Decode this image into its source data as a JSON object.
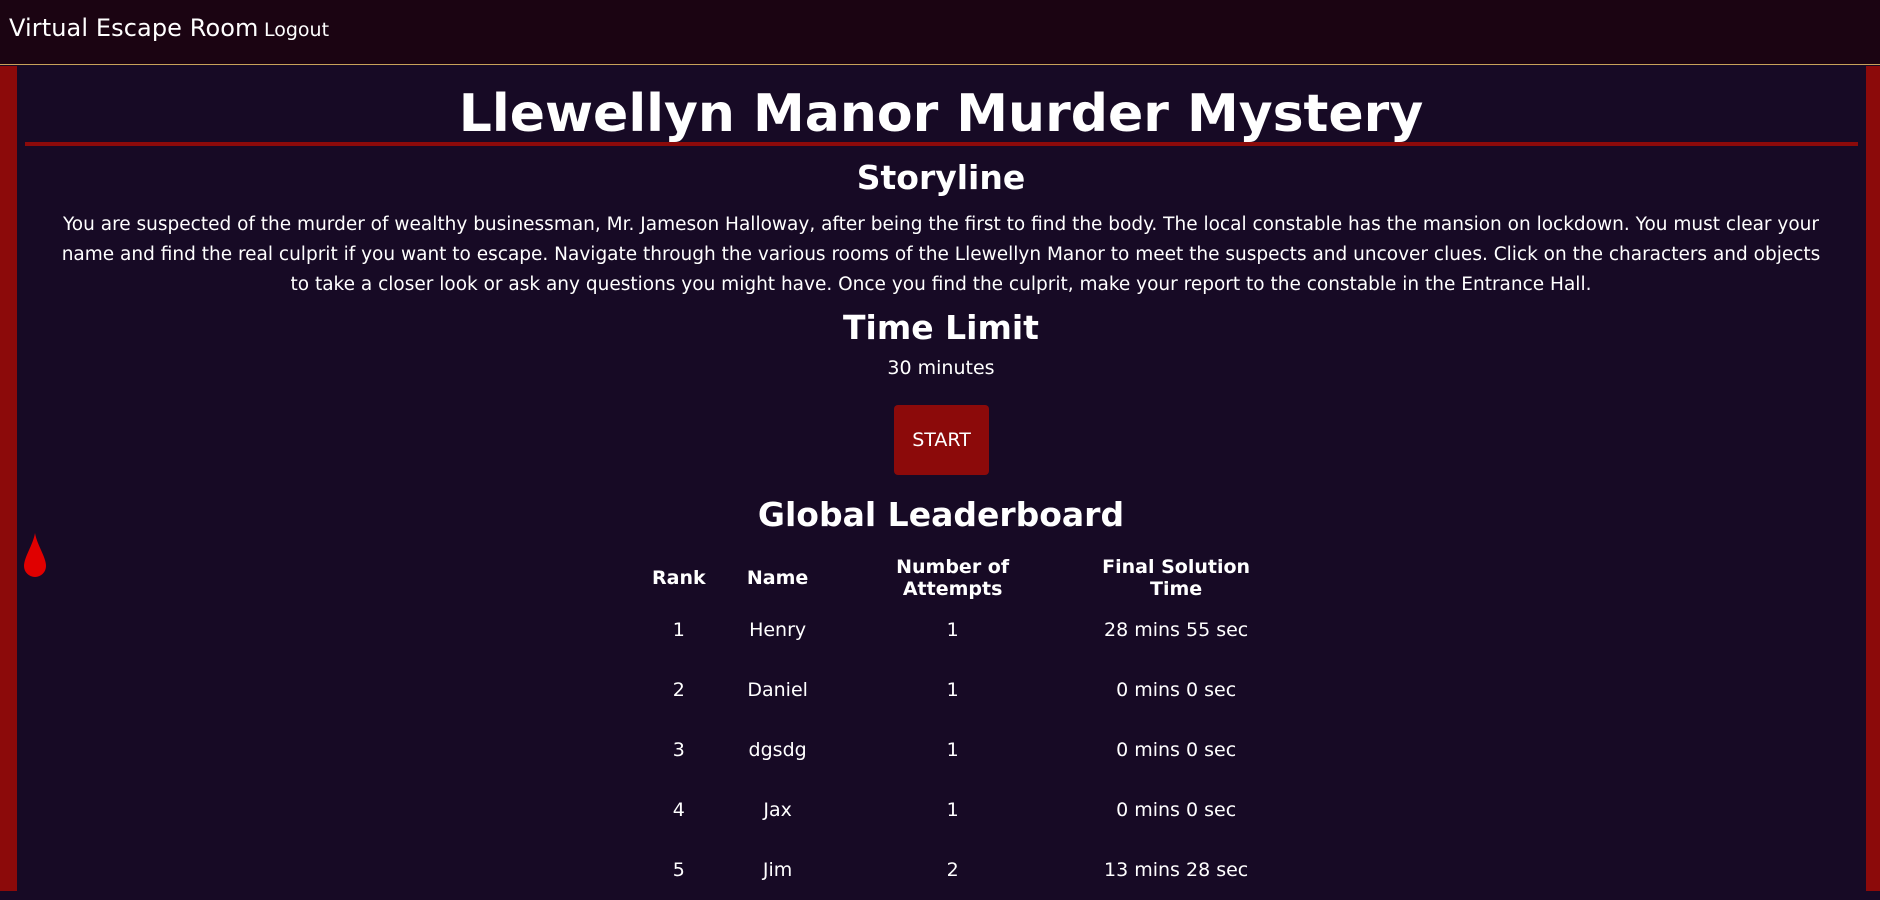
{
  "navbar": {
    "brand": "Virtual Escape Room",
    "logout_label": "Logout"
  },
  "main": {
    "title": "Llewellyn Manor Murder Mystery",
    "storyline_heading": "Storyline",
    "storyline_text": "You are suspected of the murder of wealthy businessman, Mr. Jameson Halloway, after being the first to find the body. The local constable has the mansion on lockdown. You must clear your name and find the real culprit if you want to escape. Navigate through the various rooms of the Llewellyn Manor to meet the suspects and uncover clues. Click on the characters and objects to take a closer look or ask any questions you might have. Once you find the culprit, make your report to the constable in the Entrance Hall.",
    "time_limit_heading": "Time Limit",
    "time_limit_value": "30 minutes",
    "start_label": "START",
    "leaderboard_heading": "Global Leaderboard"
  },
  "leaderboard": {
    "headers": [
      "Rank",
      "Name",
      "Number of Attempts",
      "Final Solution Time"
    ],
    "rows": [
      {
        "rank": "1",
        "name": "Henry",
        "attempts": "1",
        "time": "28 mins 55 sec"
      },
      {
        "rank": "2",
        "name": "Daniel",
        "attempts": "1",
        "time": "0 mins 0 sec"
      },
      {
        "rank": "3",
        "name": "dgsdg",
        "attempts": "1",
        "time": "0 mins 0 sec"
      },
      {
        "rank": "4",
        "name": "Jax",
        "attempts": "1",
        "time": "0 mins 0 sec"
      },
      {
        "rank": "5",
        "name": "Jim",
        "attempts": "2",
        "time": "13 mins 28 sec"
      }
    ]
  },
  "colors": {
    "background": "#170a25",
    "navbar": "#1b0412",
    "accent_red": "#8c0a0a",
    "drip_red": "#e00000",
    "navbar_border": "#c8a25a"
  },
  "icons": {
    "drip": "blood-drop-icon"
  }
}
